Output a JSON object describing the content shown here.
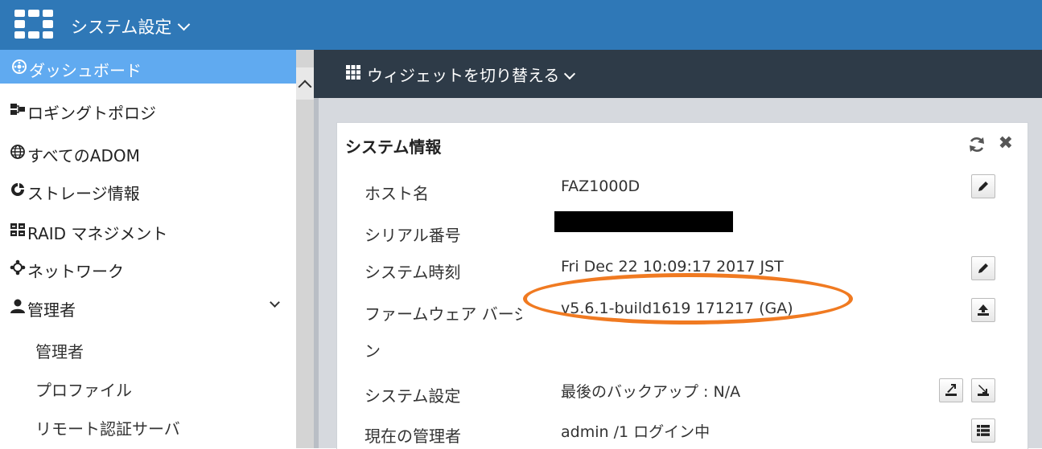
{
  "topbar": {
    "title": "システム設定",
    "icon": "fortinet-logo"
  },
  "sidebar": {
    "items": [
      {
        "label": "ダッシュボード",
        "icon": "dashboard-icon",
        "active": true
      },
      {
        "label": "ロギングトポロジ",
        "icon": "topology-icon"
      },
      {
        "label": "すべてのADOM",
        "icon": "globe-icon"
      },
      {
        "label": "ストレージ情報",
        "icon": "storage-pie-icon"
      },
      {
        "label": "RAID マネジメント",
        "icon": "raid-icon"
      },
      {
        "label": "ネットワーク",
        "icon": "network-icon"
      },
      {
        "label": "管理者",
        "icon": "user-icon",
        "expanded": true
      }
    ],
    "subitems": [
      {
        "label": "管理者"
      },
      {
        "label": "プロファイル"
      },
      {
        "label": "リモート認証サーバ"
      }
    ]
  },
  "toolbar": {
    "toggle_widgets_label": "ウィジェットを切り替える"
  },
  "widget": {
    "title": "システム情報",
    "rows": [
      {
        "label": "ホスト名",
        "value": "FAZ1000D"
      },
      {
        "label": "シリアル番号",
        "value": ""
      },
      {
        "label": "システム時刻",
        "value": "Fri Dec 22 10:09:17 2017 JST"
      },
      {
        "label": "ファームウェア バージョ",
        "label_overflow": "ン",
        "value": "v5.6.1-build1619 171217 (GA)"
      },
      {
        "label": "システム設定",
        "value": "最後のバックアップ : N/A"
      },
      {
        "label": "現在の管理者",
        "value": "admin /1 ログイン中"
      }
    ]
  },
  "colors": {
    "topbar": "#2f78b7",
    "toolbar": "#2e3b48",
    "active_nav": "#60aaf0",
    "highlight": "#f07a21"
  }
}
